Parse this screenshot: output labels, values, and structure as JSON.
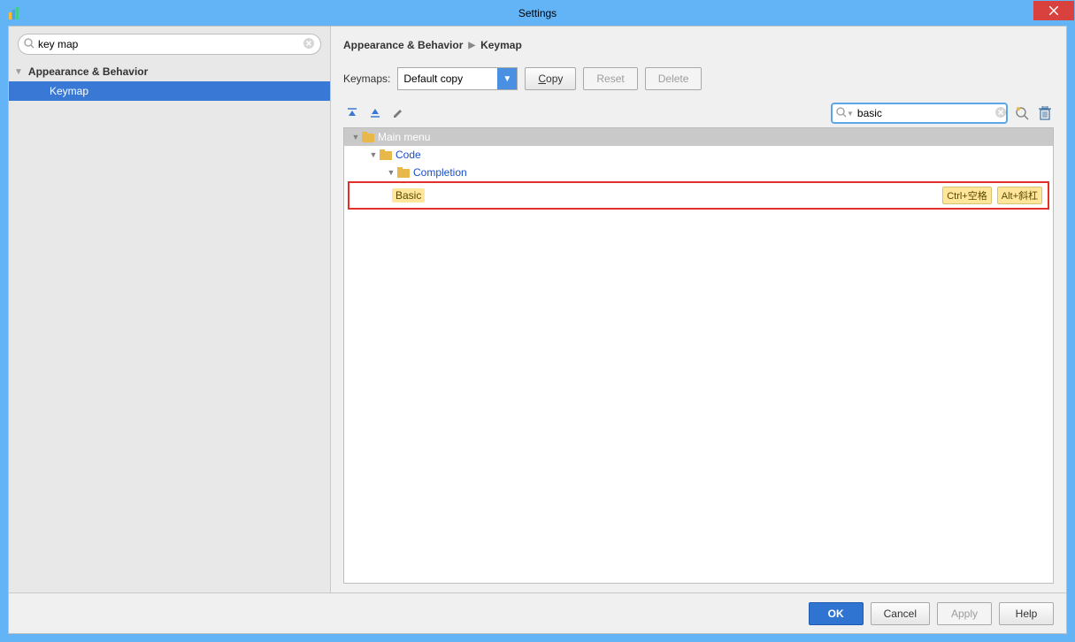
{
  "window": {
    "title": "Settings"
  },
  "sidebar": {
    "search_value": "key map",
    "group_label": "Appearance & Behavior",
    "item_label": "Keymap"
  },
  "breadcrumb": {
    "part1": "Appearance & Behavior",
    "part2": "Keymap"
  },
  "keymaps": {
    "label": "Keymaps:",
    "selected": "Default copy",
    "copy": "opy",
    "reset": "Reset",
    "delete": "Delete"
  },
  "action_search": {
    "value": "basic"
  },
  "tree": {
    "root": "Main menu",
    "code": "Code",
    "completion": "Completion",
    "action_name": "Basic",
    "shortcut1": "Ctrl+空格",
    "shortcut2": "Alt+斜杠"
  },
  "buttons": {
    "ok": "OK",
    "cancel": "Cancel",
    "apply": "Apply",
    "help": "Help"
  }
}
